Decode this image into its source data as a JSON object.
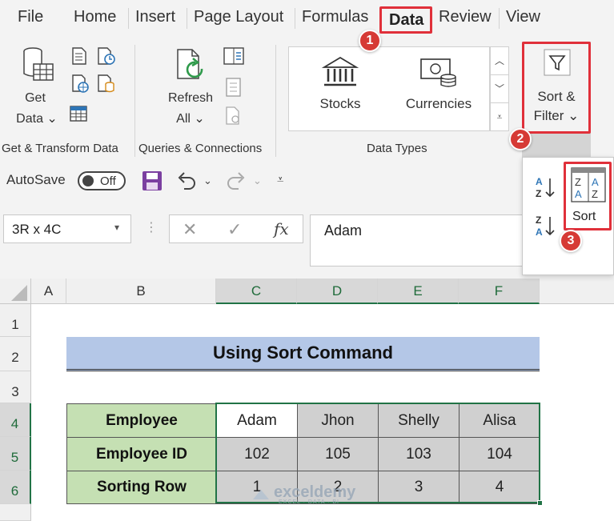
{
  "menu": {
    "file": "File",
    "home": "Home",
    "insert": "Insert",
    "page_layout": "Page Layout",
    "formulas": "Formulas",
    "data": "Data",
    "review": "Review",
    "view": "View"
  },
  "ribbon": {
    "get_data_line1": "Get",
    "get_data_line2": "Data",
    "refresh_line1": "Refresh",
    "refresh_line2": "All",
    "stocks": "Stocks",
    "currencies": "Currencies",
    "sort_filter_line1": "Sort &",
    "sort_filter_line2": "Filter",
    "group_get_transform": "Get & Transform Data",
    "group_queries": "Queries & Connections",
    "group_data_types": "Data Types"
  },
  "qat": {
    "autosave_label": "AutoSave",
    "autosave_state": "Off"
  },
  "formula_bar": {
    "name_box": "3R x 4C",
    "fx": "fx",
    "value": "Adam"
  },
  "dropdown": {
    "sort_label": "Sort"
  },
  "badges": [
    "1",
    "2",
    "3"
  ],
  "sheet": {
    "columns": [
      "A",
      "B",
      "C",
      "D",
      "E",
      "F"
    ],
    "rows": [
      "1",
      "2",
      "3",
      "4",
      "5",
      "6"
    ],
    "title": "Using Sort Command",
    "table": [
      {
        "label": "Employee",
        "values": [
          "Adam",
          "Jhon",
          "Shelly",
          "Alisa"
        ]
      },
      {
        "label": "Employee ID",
        "values": [
          "102",
          "105",
          "103",
          "104"
        ]
      },
      {
        "label": "Sorting Row",
        "values": [
          "1",
          "2",
          "3",
          "4"
        ]
      }
    ]
  },
  "watermark": {
    "name": "exceldemy",
    "tagline": "EXCEL · DATA · BI"
  },
  "colors": {
    "highlight_red": "#e0303a",
    "badge_red": "#d63a35",
    "label_green": "#c5e0b3",
    "title_blue": "#b4c7e7",
    "value_gray": "#d0d0d0",
    "excel_green": "#217346"
  }
}
